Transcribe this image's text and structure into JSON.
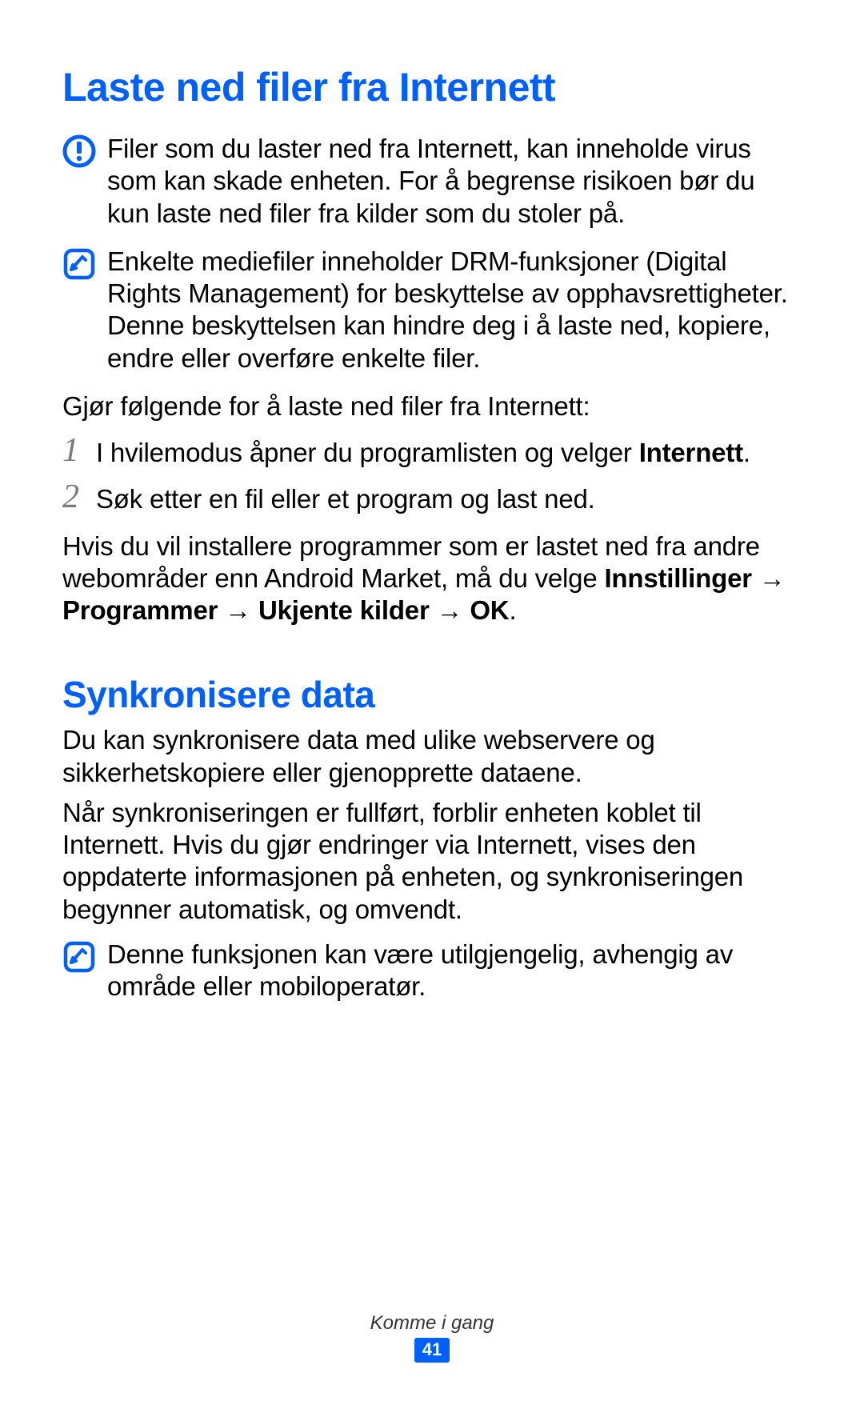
{
  "section1": {
    "heading": "Laste ned filer fra Internett",
    "warning": "Filer som du laster ned fra Internett, kan inneholde virus som kan skade enheten. For å begrense risikoen bør du kun laste ned filer fra kilder som du stoler på.",
    "note1": "Enkelte mediefiler inneholder DRM-funksjoner (Digital Rights Management) for beskyttelse av opphavsrettigheter. Denne beskyttelsen kan hindre deg i å laste ned, kopiere, endre eller overføre enkelte filer.",
    "intro": "Gjør følgende for å laste ned filer fra Internett:",
    "step1_num": "1",
    "step1_prefix": "I hvilemodus åpner du programlisten og velger ",
    "step1_bold": "Internett",
    "step1_suffix": ".",
    "step2_num": "2",
    "step2": "Søk etter en fil eller et program og last ned.",
    "followup_prefix": "Hvis du vil installere programmer som er lastet ned fra andre webområder enn Android Market, må du velge ",
    "followup_bold": "Innstillinger → Programmer → Ukjente kilder → OK",
    "followup_suffix": "."
  },
  "section2": {
    "heading": "Synkronisere data",
    "para1": "Du kan synkronisere data med ulike webservere og sikkerhetskopiere eller gjenopprette dataene.",
    "para2": "Når synkroniseringen er fullført, forblir enheten koblet til Internett. Hvis du gjør endringer via Internett, vises den oppdaterte informasjonen på enheten, og synkroniseringen begynner automatisk, og omvendt.",
    "note": "Denne funksjonen kan være utilgjengelig, avhengig av område eller mobiloperatør."
  },
  "footer": {
    "chapter": "Komme i gang",
    "page": "41"
  }
}
